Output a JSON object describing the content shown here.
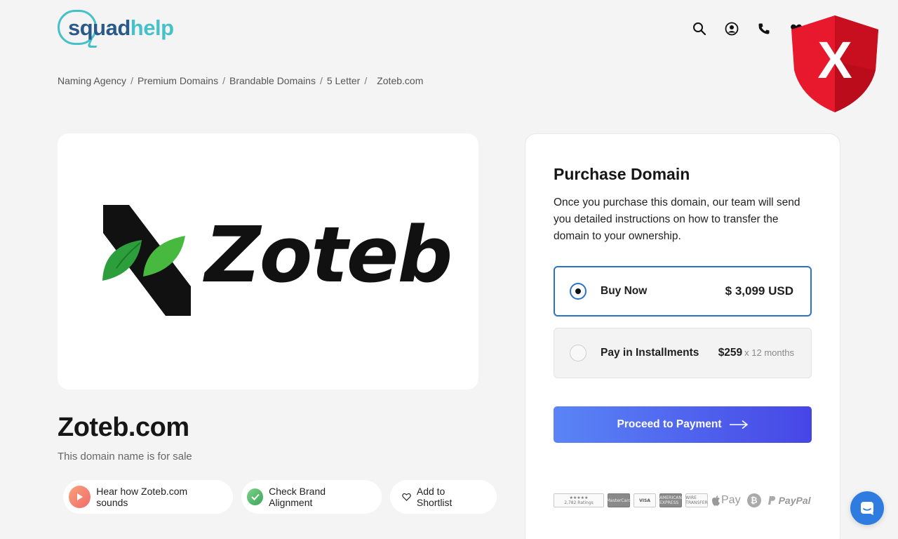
{
  "header": {
    "logo_part1": "squad",
    "logo_part2": "help",
    "icons": [
      "search-icon",
      "account-icon",
      "phone-icon",
      "heart-icon"
    ]
  },
  "overlay": {
    "icon": "shield-x-icon",
    "label": "X"
  },
  "breadcrumb": {
    "items": [
      "Naming Agency",
      "Premium Domains",
      "Brandable Domains",
      "5 Letter"
    ],
    "separator": "/",
    "current": "Zoteb.com"
  },
  "listing": {
    "logo_text": "Zoteb",
    "domain": "Zoteb.com",
    "subtitle": "This domain name is for sale",
    "actions": {
      "sound": "Hear how Zoteb.com sounds",
      "brand": "Check Brand Alignment",
      "shortlist": "Add to Shortlist"
    }
  },
  "purchase": {
    "title": "Purchase Domain",
    "description": "Once you purchase this domain, our team will send you detailed instructions on how to transfer the domain to your ownership.",
    "options": [
      {
        "label": "Buy Now",
        "price": "$ 3,099 USD",
        "selected": true
      },
      {
        "label": "Pay in Installments",
        "price": "$259",
        "price_suffix": "x 12 months",
        "selected": false
      }
    ],
    "cta": "Proceed to Payment",
    "payment_methods": {
      "ratings": "2,782 Ratings",
      "badges": [
        "MasterCard",
        "VISA",
        "AMERICAN EXPRESS",
        "WIRE TRANSFER"
      ],
      "apple_pay": "Pay",
      "paypal": "PayPal"
    }
  },
  "chat": {
    "icon": "chat-icon"
  },
  "colors": {
    "primary_blue": "#2a72c9",
    "teal": "#46c1c9",
    "cta_start": "#5a85f6",
    "cta_end": "#4646e6"
  }
}
